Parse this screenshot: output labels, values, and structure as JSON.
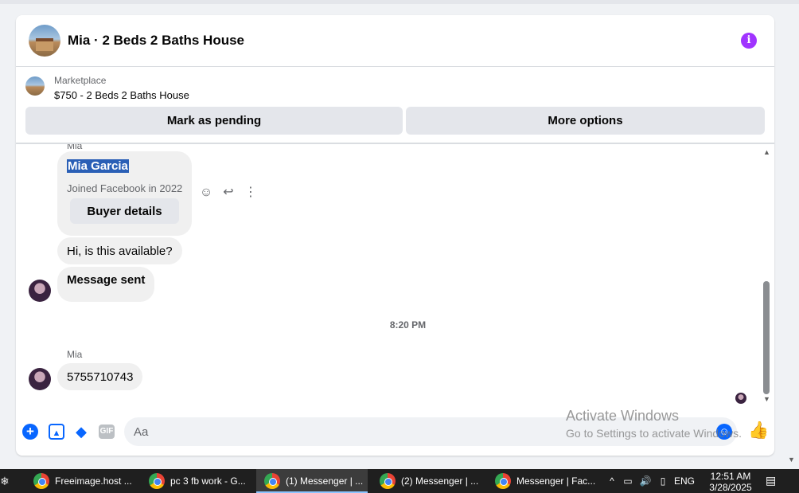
{
  "header": {
    "title": "Mia · 2 Beds 2 Baths House",
    "avatar_icon": "house-photo-icon",
    "info_icon": "info-icon"
  },
  "marketplace": {
    "label": "Marketplace",
    "listing": "$750 - 2 Beds 2 Baths House",
    "actions": {
      "pending_label": "Mark as pending",
      "more_label": "More options"
    }
  },
  "messages": {
    "top_sender": "Mia",
    "buyer_card": {
      "name": "Mia Garcia",
      "joined": "Joined Facebook in 2022",
      "button_label": "Buyer details"
    },
    "bubble_1": "Hi, is this available?",
    "bubble_2": "Message sent",
    "timestamp": "8:20 PM",
    "second_sender": "Mia",
    "bubble_3": "5755710743"
  },
  "composer": {
    "placeholder": "Aa"
  },
  "watermark": {
    "line1": "Activate Windows",
    "line2": "Go to Settings to activate Windows."
  },
  "taskbar": {
    "items": [
      {
        "label": "Freeimage.host ..."
      },
      {
        "label": "pc 3 fb work - G..."
      },
      {
        "label": "(1) Messenger | ..."
      },
      {
        "label": "(2) Messenger | ..."
      },
      {
        "label": "Messenger | Fac..."
      }
    ],
    "language": "ENG",
    "time": "12:51 AM",
    "date": "3/28/2025"
  },
  "colors": {
    "accent": "#0866ff",
    "info": "#a033ff",
    "selection": "#2a5fb6"
  }
}
